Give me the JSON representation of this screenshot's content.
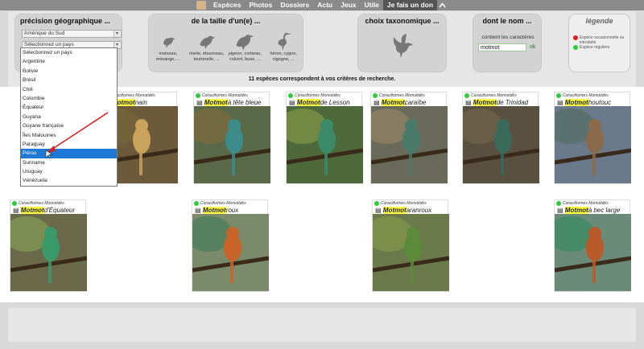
{
  "nav": {
    "items": [
      "Espèces",
      "Photos",
      "Dossiers",
      "Actu",
      "Jeux",
      "Utile",
      "Je fais un don"
    ],
    "active_index": 6
  },
  "geo": {
    "title": "précision géographique ...",
    "region": "Amérique du Sud",
    "country_placeholder": "Sélectionnez un pays",
    "options": [
      "Sélectionnez un pays",
      "Argentine",
      "Bolivie",
      "Brésil",
      "Chili",
      "Colombie",
      "Équateur",
      "Guyana",
      "Guyane française",
      "Îles Malouines",
      "Paraguay",
      "Pérou",
      "Suriname",
      "Uruguay",
      "Vénézuela"
    ],
    "highlighted": "Pérou"
  },
  "size": {
    "title": "de la taille d'un(e) ...",
    "birds": [
      {
        "label": "moineau, mésange, ...",
        "icon": "sparrow-icon"
      },
      {
        "label": "merle, étourneau, tourterelle, ...",
        "icon": "blackbird-icon"
      },
      {
        "label": "pigeon, corbeau, colvert, buse, ...",
        "icon": "pigeon-icon"
      },
      {
        "label": "héron, cygne, cigogne, ...",
        "icon": "heron-icon"
      }
    ]
  },
  "tax": {
    "title": "choix taxonomique ...",
    "icon": "bird-silhouette-icon"
  },
  "name": {
    "title": "dont le nom ...",
    "label": "contient les caractères",
    "value": "motmot",
    "ok": "ok"
  },
  "legend": {
    "title": "légende",
    "items": [
      {
        "text": "Espèce occasionnelle ou introduite",
        "color": "#d62020"
      },
      {
        "text": "Espèce régulière",
        "color": "#2ecc3a"
      }
    ]
  },
  "results": "11 espèces correspondent à vos critères de recherche.",
  "colors": {
    "highlight": "#ffff44",
    "regular_dot": "#2ecc3a",
    "selection": "#1e78d6"
  },
  "species": [
    {
      "order": "Coraciiformes",
      "family": "Momotidés",
      "hl": "Motmot",
      "rest": "nain"
    },
    {
      "order": "Coraciiformes",
      "family": "Momotidés",
      "hl": "Motmot",
      "rest": "à tête bleue"
    },
    {
      "order": "Coraciiformes",
      "family": "Momotidés",
      "hl": "Motmot",
      "rest": "de Lesson"
    },
    {
      "order": "Coraciiformes",
      "family": "Momotidés",
      "hl": "Motmot",
      "rest": "caraïbe"
    },
    {
      "order": "Coraciiformes",
      "family": "Momotidés",
      "hl": "Motmot",
      "rest": "de Trinidad"
    },
    {
      "order": "Coraciiformes",
      "family": "Momotidés",
      "hl": "Motmot",
      "rest": "houtouc"
    },
    {
      "order": "Coraciiformes",
      "family": "Momotidés",
      "hl": "Motmot",
      "rest": "d'Équateur"
    },
    {
      "order": "Coraciiformes",
      "family": "Momotidés",
      "hl": "Motmot",
      "rest": "roux"
    },
    {
      "order": "Coraciiformes",
      "family": "Momotidés",
      "hl": "Motmot",
      "rest": "aranroux"
    },
    {
      "order": "Coraciiformes",
      "family": "Momotidés",
      "hl": "Motmot",
      "rest": "à bec large"
    }
  ]
}
